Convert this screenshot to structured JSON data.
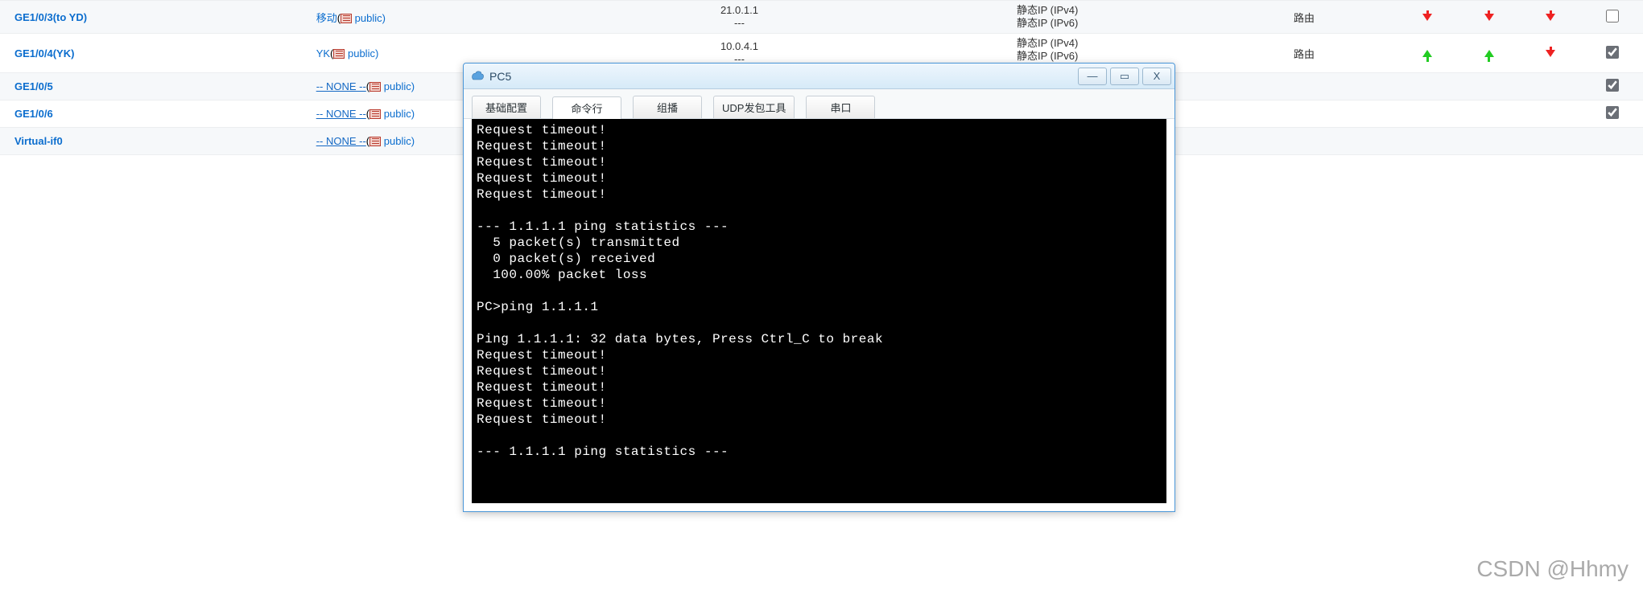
{
  "rows": [
    {
      "iface": "GE1/0/3(to YD)",
      "netLabel": "移动",
      "netSuffix": " public)",
      "ip1": "21.0.1.1",
      "ip2": "---",
      "type1": "静态IP (IPv4)",
      "type2": "静态IP (IPv6)",
      "typeExtra": "",
      "route": "路由",
      "arrows": [
        "down",
        "down",
        "down"
      ],
      "checked": false,
      "alt": true
    },
    {
      "iface": "GE1/0/4(YK)",
      "netLabel": "YK",
      "netSuffix": " public)",
      "ip1": "10.0.4.1",
      "ip2": "---",
      "type1": "静态IP (IPv4)",
      "type2": "静态IP (IPv6)",
      "typeExtra": "静态IP (IPv4)",
      "route": "路由",
      "arrows": [
        "up",
        "up",
        "down"
      ],
      "checked": true,
      "alt": false
    },
    {
      "iface": "GE1/0/5",
      "netLabel": "-- NONE --",
      "netSuffix": " public)",
      "ip1": "",
      "ip2": "",
      "type1": "",
      "type2": "",
      "typeExtra": "",
      "route": "",
      "arrows": [],
      "checked": true,
      "alt": true
    },
    {
      "iface": "GE1/0/6",
      "netLabel": "-- NONE --",
      "netSuffix": " public)",
      "ip1": "",
      "ip2": "",
      "type1": "",
      "type2": "",
      "typeExtra": "",
      "route": "",
      "arrows": [],
      "checked": true,
      "alt": false
    },
    {
      "iface": "Virtual-if0",
      "netLabel": "-- NONE --",
      "netSuffix": " public)",
      "ip1": "",
      "ip2": "",
      "type1": "",
      "type2": "",
      "typeExtra": "",
      "route": "",
      "arrows": [],
      "checked": null,
      "alt": true
    }
  ],
  "window": {
    "title": "PC5",
    "tabs": [
      "基础配置",
      "命令行",
      "组播",
      "UDP发包工具",
      "串口"
    ],
    "activeTab": 1
  },
  "terminal": "Request timeout!\nRequest timeout!\nRequest timeout!\nRequest timeout!\nRequest timeout!\n\n--- 1.1.1.1 ping statistics ---\n  5 packet(s) transmitted\n  0 packet(s) received\n  100.00% packet loss\n\nPC>ping 1.1.1.1\n\nPing 1.1.1.1: 32 data bytes, Press Ctrl_C to break\nRequest timeout!\nRequest timeout!\nRequest timeout!\nRequest timeout!\nRequest timeout!\n\n--- 1.1.1.1 ping statistics ---",
  "watermark": "CSDN @Hhmy"
}
